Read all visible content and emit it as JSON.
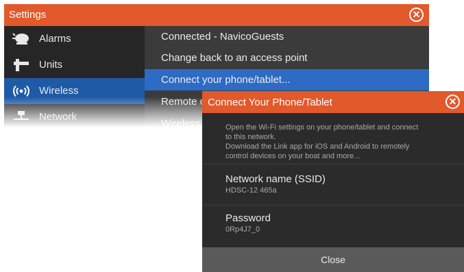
{
  "settings": {
    "title": "Settings",
    "close_icon": "close-icon",
    "sidebar": {
      "items": [
        {
          "label": "Alarms",
          "icon": "alarm-icon"
        },
        {
          "label": "Units",
          "icon": "units-icon"
        },
        {
          "label": "Wireless",
          "icon": "wireless-icon",
          "selected": true
        },
        {
          "label": "Network",
          "icon": "network-icon"
        }
      ]
    },
    "options": [
      {
        "label": "Connected - NavicoGuests"
      },
      {
        "label": "Change back to an access point"
      },
      {
        "label": "Connect your phone/tablet...",
        "selected": true
      },
      {
        "label": "Remote c"
      },
      {
        "label": "Wireless"
      }
    ]
  },
  "dialog": {
    "title": "Connect Your Phone/Tablet",
    "description": [
      "Open the Wi-Fi settings on your phone/tablet and connect",
      "to this network.",
      "Download the Link app for iOS and Android to remotely",
      "control devices on your boat and more..."
    ],
    "ssid": {
      "label": "Network name (SSID)",
      "value": "HDSC-12 465a"
    },
    "password": {
      "label": "Password",
      "value": "0Rp4J7_0"
    },
    "close_label": "Close"
  },
  "colors": {
    "header_orange": "#e2592b",
    "selected_blue": "#2d6bc4",
    "sidebar_selected": "#1f5aa6",
    "panel_dark": "#262626",
    "panel": "#3b3b3b"
  }
}
